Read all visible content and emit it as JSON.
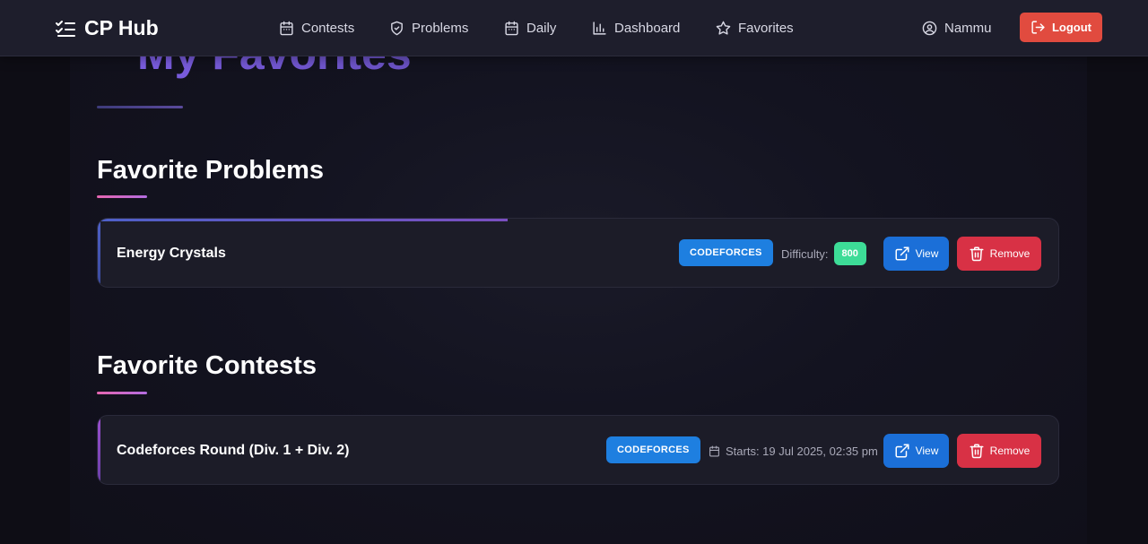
{
  "nav": {
    "brand": "CP Hub",
    "items": [
      {
        "label": "Contests",
        "icon": "calendar-icon"
      },
      {
        "label": "Problems",
        "icon": "shield-icon"
      },
      {
        "label": "Daily",
        "icon": "calendar-icon"
      },
      {
        "label": "Dashboard",
        "icon": "bar-chart-icon"
      },
      {
        "label": "Favorites",
        "icon": "star-icon"
      }
    ],
    "user": "Nammu",
    "logout_label": "Logout"
  },
  "page": {
    "title": "My Favorites"
  },
  "favorite_problems": {
    "heading": "Favorite Problems",
    "items": [
      {
        "name": "Energy Crystals",
        "platform": "CODEFORCES",
        "difficulty_label": "Difficulty:",
        "difficulty": "800",
        "view_label": "View",
        "remove_label": "Remove"
      }
    ]
  },
  "favorite_contests": {
    "heading": "Favorite Contests",
    "items": [
      {
        "name": "Codeforces Round (Div. 1 + Div. 2)",
        "platform": "CODEFORCES",
        "starts": "Starts: 19 Jul 2025, 02:35 pm",
        "view_label": "View",
        "remove_label": "Remove"
      }
    ]
  },
  "colors": {
    "accent": "#7b5de0",
    "platform_badge": "#1e7fe0",
    "difficulty_badge": "#3ddc97",
    "view_button": "#1b6fd8",
    "remove_button": "#d83145",
    "logout_button": "#e14b3f"
  }
}
